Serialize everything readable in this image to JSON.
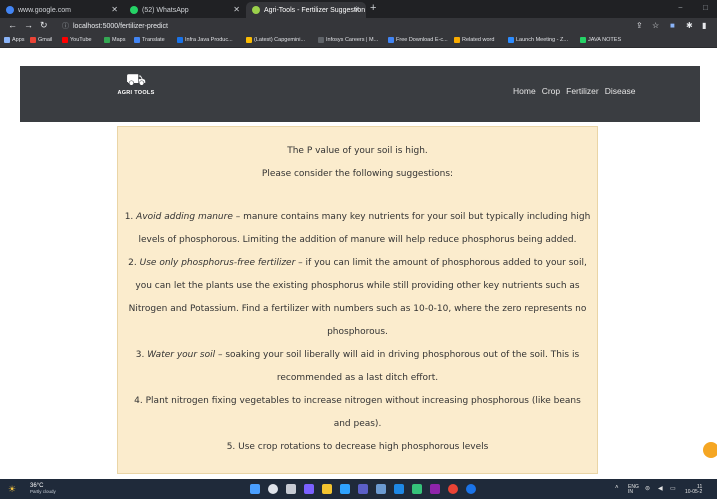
{
  "browser": {
    "tabs": [
      {
        "label": "www.google.com",
        "icon_color": "#4285f4"
      },
      {
        "label": "(52) WhatsApp",
        "icon_color": "#25d366"
      },
      {
        "label": "Agri-Tools - Fertilizer Suggestion",
        "icon_color": "#9bd14b"
      }
    ],
    "new_tab": "+",
    "window_controls": {
      "minimize": "−",
      "restore": "□"
    },
    "url": "localhost:5000/fertilizer-predict",
    "bookmarks": [
      {
        "label": "Apps",
        "color": "#8ab4f8"
      },
      {
        "label": "Gmail",
        "color": "#ea4335"
      },
      {
        "label": "YouTube",
        "color": "#ff0000"
      },
      {
        "label": "Maps",
        "color": "#34a853"
      },
      {
        "label": "Translate",
        "color": "#4285f4"
      },
      {
        "label": "Infra Java Produc...",
        "color": "#1a73e8"
      },
      {
        "label": "(Latest) Capgemini...",
        "color": "#fbbc04"
      },
      {
        "label": "Infosys Careers | M...",
        "color": "#5f6368"
      },
      {
        "label": "Free Download E-c...",
        "color": "#4285f4"
      },
      {
        "label": "Related word",
        "color": "#f9ab00"
      },
      {
        "label": "Launch Meeting - Z...",
        "color": "#2d8cff"
      },
      {
        "label": "JAVA NOTES",
        "color": "#25d366"
      }
    ]
  },
  "site": {
    "logo_text": "AGRI TOOLS",
    "nav": [
      "Home",
      "Crop",
      "Fertilizer",
      "Disease"
    ]
  },
  "suggestion": {
    "heading": "The P value of your soil is high.",
    "subheading": "Please consider the following suggestions:",
    "items": [
      {
        "num": "1.",
        "title": "Avoid adding manure",
        "text": "– manure contains many key nutrients for your soil but typically including high"
      },
      {
        "cont1": "levels of phosphorous. Limiting the addition of manure will help reduce phosphorus being added."
      },
      {
        "num": "2.",
        "title": "Use only phosphorus-free fertilizer",
        "text": "– if you can limit the amount of phosphorous added to your soil,"
      },
      {
        "cont1": "you can let the plants use the existing phosphorus while still providing other key nutrients such as"
      },
      {
        "cont1": "Nitrogen and Potassium. Find a fertilizer with numbers such as 10-0-10, where the zero represents no"
      },
      {
        "cont1": "phosphorous."
      },
      {
        "num": "3.",
        "title": "Water your soil",
        "text": "– soaking your soil liberally will aid in driving phosphorous out of the soil. This is"
      },
      {
        "cont1": "recommended as a last ditch effort."
      },
      {
        "cont1": "4. Plant nitrogen fixing vegetables to increase nitrogen without increasing phosphorous (like beans"
      },
      {
        "cont1": "and peas)."
      },
      {
        "cont1": "5. Use crop rotations to decrease high phosphorous levels"
      }
    ]
  },
  "taskbar": {
    "temp": "36°C",
    "weather": "Partly cloudy",
    "lang": "ENG",
    "lang_sub": "IN",
    "time": "11",
    "date": "10-05-2"
  }
}
